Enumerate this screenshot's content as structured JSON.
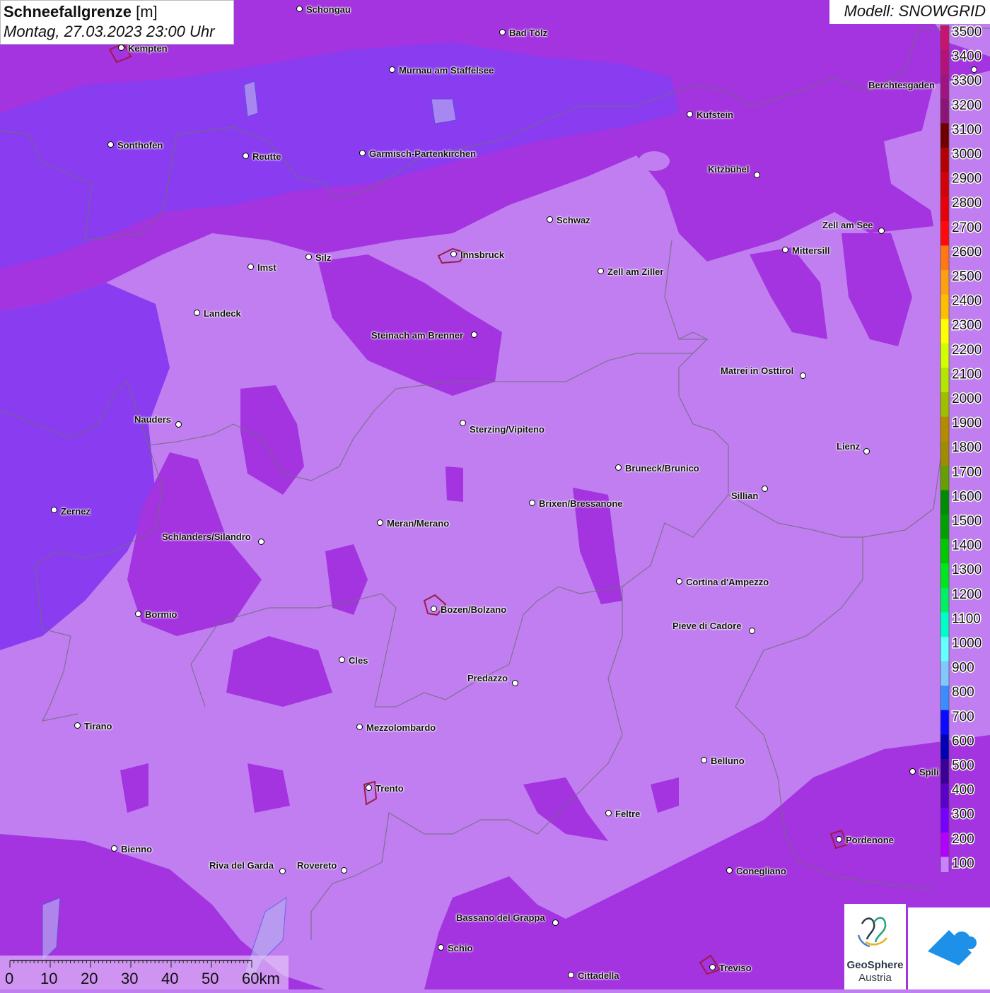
{
  "title": {
    "label": "Schneefallgrenze",
    "unit": "[m]",
    "datetime": "Montag, 27.03.2023 23:00 Uhr"
  },
  "model": "Modell: SNOWGRID",
  "legend": {
    "ticks": [
      "3500",
      "3400",
      "3300",
      "3200",
      "3100",
      "3000",
      "2900",
      "2800",
      "2700",
      "2600",
      "2500",
      "2400",
      "2300",
      "2200",
      "2100",
      "2000",
      "1900",
      "1800",
      "1700",
      "1600",
      "1500",
      "1400",
      "1300",
      "1200",
      "1100",
      "1000",
      "900",
      "800",
      "700",
      "600",
      "500",
      "400",
      "300",
      "200",
      "100"
    ],
    "colors": [
      "#c8146e",
      "#b4127a",
      "#a01482",
      "#8c1478",
      "#6e0000",
      "#b40000",
      "#d2000a",
      "#e6000a",
      "#ff0a0a",
      "#ff7814",
      "#ffa014",
      "#ffbe00",
      "#ffff00",
      "#d2ff00",
      "#b4e600",
      "#a0be00",
      "#b48c00",
      "#a08c00",
      "#64a000",
      "#008c00",
      "#00a000",
      "#00c800",
      "#00e61e",
      "#00f064",
      "#00ffc8",
      "#64ffff",
      "#82c8ff",
      "#3c8cff",
      "#0a0aff",
      "#0000b4",
      "#3c0096",
      "#5a00c8",
      "#7800ff",
      "#b400ff",
      "#c882ff"
    ]
  },
  "scale": {
    "labels": [
      "0",
      "10",
      "20",
      "30",
      "40",
      "50",
      "60km"
    ]
  },
  "logo": {
    "line1": "GeoSphere",
    "line2": "Austria"
  },
  "cities": [
    {
      "name": "Schongau",
      "label": "Schongau"
    },
    {
      "name": "Bad Tölz",
      "label": "Bad Tölz"
    },
    {
      "name": "Kempten",
      "label": "Kempten"
    },
    {
      "name": "Murnau",
      "label": "Murnau am Staffelsee"
    },
    {
      "name": "Berchtesgaden",
      "label": "Berchtesgaden"
    },
    {
      "name": "Kufstein",
      "label": "Kufstein"
    },
    {
      "name": "Sonthofen",
      "label": "Sonthofen"
    },
    {
      "name": "Reutte",
      "label": "Reutte"
    },
    {
      "name": "Garmisch",
      "label": "Garmisch-Partenkirchen"
    },
    {
      "name": "Kitzbühel",
      "label": "Kitzbühel"
    },
    {
      "name": "Schwaz",
      "label": "Schwaz"
    },
    {
      "name": "Zell am See",
      "label": "Zell am See"
    },
    {
      "name": "Innsbruck",
      "label": "Innsbruck"
    },
    {
      "name": "Mittersill",
      "label": "Mittersill"
    },
    {
      "name": "Imst",
      "label": "Imst"
    },
    {
      "name": "Silz",
      "label": "Silz"
    },
    {
      "name": "Zell am Ziller",
      "label": "Zell am Ziller"
    },
    {
      "name": "Landeck",
      "label": "Landeck"
    },
    {
      "name": "Steinach",
      "label": "Steinach am Brenner"
    },
    {
      "name": "Matrei",
      "label": "Matrei in Osttirol"
    },
    {
      "name": "Nauders",
      "label": "Nauders"
    },
    {
      "name": "Sterzing",
      "label": "Sterzing/Vipiteno"
    },
    {
      "name": "Lienz",
      "label": "Lienz"
    },
    {
      "name": "Bruneck",
      "label": "Bruneck/Brunico"
    },
    {
      "name": "Sillian",
      "label": "Sillian"
    },
    {
      "name": "Brixen",
      "label": "Brixen/Bressanone"
    },
    {
      "name": "Zernez",
      "label": "Zernez"
    },
    {
      "name": "Meran",
      "label": "Meran/Merano"
    },
    {
      "name": "Schlanders",
      "label": "Schlanders/Silandro"
    },
    {
      "name": "Cortina",
      "label": "Cortina d'Ampezzo"
    },
    {
      "name": "Bozen",
      "label": "Bozen/Bolzano"
    },
    {
      "name": "Bormio",
      "label": "Bormio"
    },
    {
      "name": "Pieve",
      "label": "Pieve di Cadore"
    },
    {
      "name": "Cles",
      "label": "Cles"
    },
    {
      "name": "Predazzo",
      "label": "Predazzo"
    },
    {
      "name": "Tirano",
      "label": "Tirano"
    },
    {
      "name": "Mezzolombardo",
      "label": "Mezzolombardo"
    },
    {
      "name": "Belluno",
      "label": "Belluno"
    },
    {
      "name": "Spilimbergo",
      "label": "Spili"
    },
    {
      "name": "Trento",
      "label": "Trento"
    },
    {
      "name": "Feltre",
      "label": "Feltre"
    },
    {
      "name": "Pordenone",
      "label": "Pordenone"
    },
    {
      "name": "Bienno",
      "label": "Bienno"
    },
    {
      "name": "Riva",
      "label": "Riva del Garda"
    },
    {
      "name": "Rovereto",
      "label": "Rovereto"
    },
    {
      "name": "Conegliano",
      "label": "Conegliano"
    },
    {
      "name": "Bassano",
      "label": "Bassano del Grappa"
    },
    {
      "name": "Schio",
      "label": "Schio"
    },
    {
      "name": "Treviso",
      "label": "Treviso"
    },
    {
      "name": "Cittadella",
      "label": "Cittadella"
    }
  ]
}
